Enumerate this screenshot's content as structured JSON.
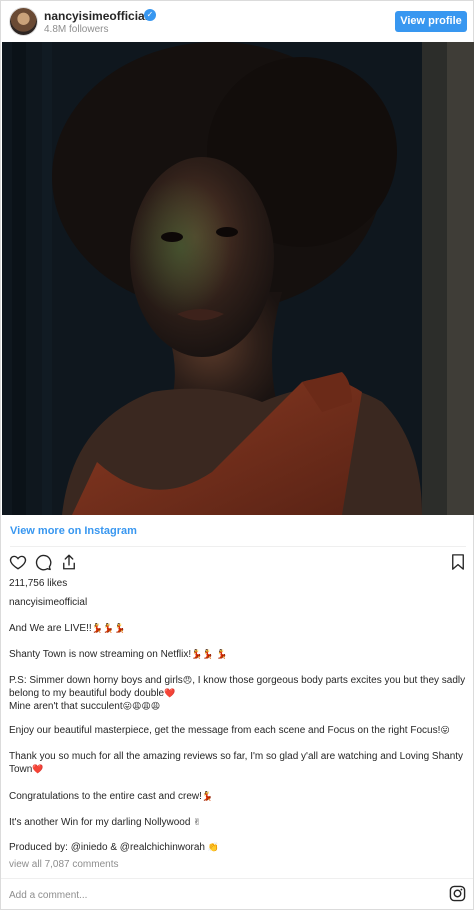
{
  "header": {
    "username": "nancyisimeofficial",
    "verified_glyph": "✓",
    "followers": "4.8M followers",
    "view_profile_label": "View profile"
  },
  "media": {
    "alt_description": "",
    "icon": "portrait-photo"
  },
  "view_more_label": "View more on Instagram",
  "actions": {
    "icons": [
      "heart-icon",
      "comment-icon",
      "share-icon",
      "bookmark-icon"
    ]
  },
  "likes": "211,756 likes",
  "owner": "nancyisimeofficial",
  "caption": {
    "line1": "And We are LIVE!!",
    "line1_emoji": "💃💃💃",
    "line2": "Shanty Town is now streaming on Netflix!",
    "line2_emoji": "💃💃 💃",
    "line3a": "P.S: Simmer down horny boys and girls",
    "line3a_emoji": "😠",
    "line3b": ", I know those gorgeous body parts excites you but they sadly belong to my beautiful body double",
    "line3b_emoji": "❤️",
    "line3c": "Mine aren't that succulent",
    "line3c_emoji": "😛😩😩😩",
    "line4": "Enjoy our beautiful masterpiece, get the message from each scene and Focus on the right Focus!",
    "line4_emoji": "😛",
    "line5": "Thank you so much for all the amazing reviews so far, I'm so glad y'all are watching and Loving Shanty Town",
    "line5_emoji": "❤️",
    "line6": "Congratulations to the entire cast and crew!",
    "line6_emoji": "💃",
    "line7": "It's another Win for my darling Nollywood",
    "line7_emoji": "✌",
    "line8_prefix": "Produced by: ",
    "line8_handle1": "@iniedo",
    "line8_amp": " & ",
    "line8_handle2": "@realchichinworah",
    "line8_emoji": "👏"
  },
  "comments_link": "view all 7,087 comments",
  "comment_input": {
    "placeholder": "Add a comment..."
  },
  "colors": {
    "accent": "#3897f0",
    "muted": "#8e8e8e",
    "text": "#262626"
  }
}
